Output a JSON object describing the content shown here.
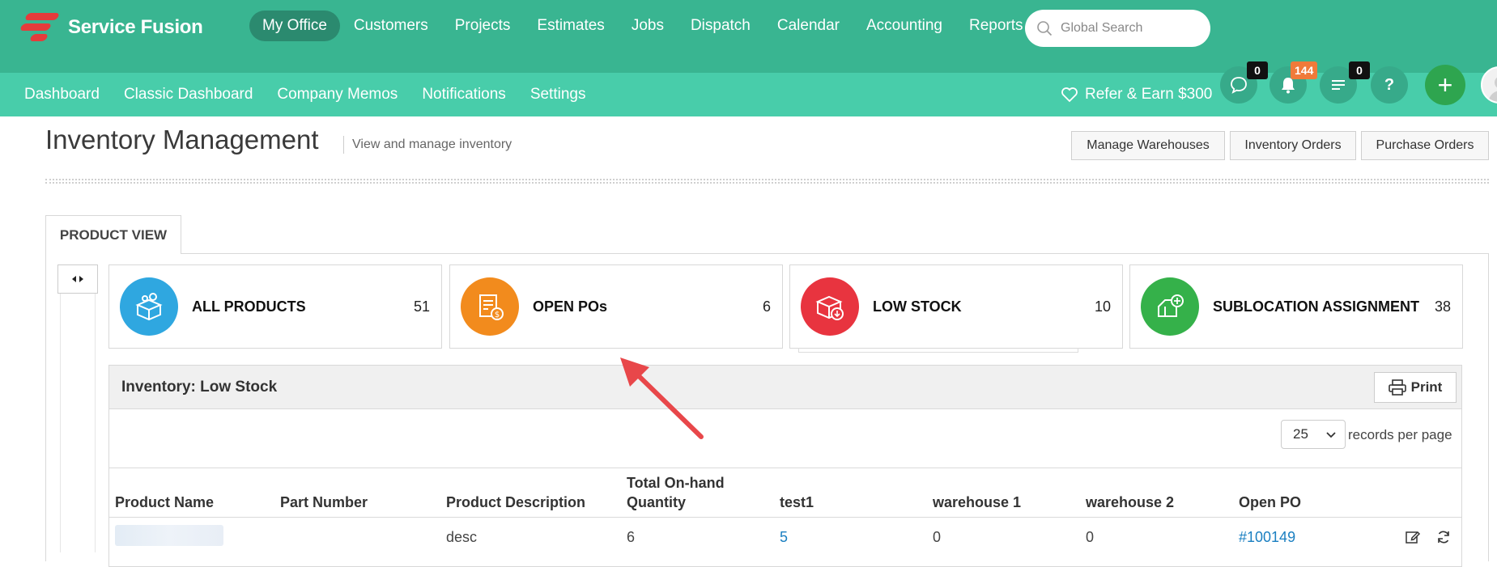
{
  "app": {
    "brand": "Service Fusion"
  },
  "top_nav": {
    "items": [
      "My Office",
      "Customers",
      "Projects",
      "Estimates",
      "Jobs",
      "Dispatch",
      "Calendar",
      "Accounting",
      "Reports"
    ],
    "active": "My Office",
    "search_placeholder": "Global Search"
  },
  "sub_nav": {
    "items": [
      "Dashboard",
      "Classic Dashboard",
      "Company Memos",
      "Notifications",
      "Settings"
    ],
    "refer": "Refer & Earn $300",
    "badges": {
      "messages": "0",
      "alerts": "144",
      "tasks": "0"
    },
    "help": "?",
    "add": "+"
  },
  "page": {
    "title": "Inventory Management",
    "subtitle": "View and manage inventory",
    "buttons": {
      "warehouses": "Manage Warehouses",
      "inventory_orders": "Inventory Orders",
      "purchase_orders": "Purchase Orders"
    }
  },
  "tabs": {
    "product_view": "PRODUCT VIEW"
  },
  "cards": [
    {
      "label": "ALL PRODUCTS",
      "count": "51",
      "icon": "boxes-gear-icon",
      "color": "#2fa7e0"
    },
    {
      "label": "OPEN POs",
      "count": "6",
      "icon": "purchase-order-icon",
      "color": "#f28b1d"
    },
    {
      "label": "LOW STOCK",
      "count": "10",
      "icon": "box-down-icon",
      "color": "#e8343f"
    },
    {
      "label": "SUBLOCATION ASSIGNMENT",
      "count": "38",
      "icon": "location-add-icon",
      "color": "#35b14a"
    }
  ],
  "panel": {
    "title": "Inventory: Low Stock",
    "print": "Print",
    "per_page_value": "25",
    "per_page_label": "records per page",
    "columns": [
      "Product Name",
      "Part Number",
      "Product Description",
      "Total On-hand Quantity",
      "test1",
      "warehouse 1",
      "warehouse 2",
      "Open PO"
    ],
    "rows": [
      {
        "product_name": "",
        "part_number": "",
        "description": "desc",
        "total": "6",
        "test1": "5",
        "wh1": "0",
        "wh2": "0",
        "open_po": "#100149"
      }
    ]
  }
}
